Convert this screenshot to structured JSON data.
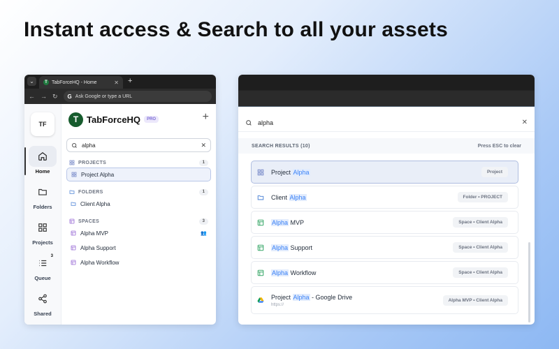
{
  "headline": "Instant access & Search to all your assets",
  "browser": {
    "tab_title": "TabForceHQ - Home",
    "tab_favicon": "T",
    "address_placeholder": "Ask Google or type a URL",
    "address_g": "G"
  },
  "sidebar": {
    "avatar": "TF",
    "items": [
      {
        "label": "Home",
        "icon": "home-icon"
      },
      {
        "label": "Folders",
        "icon": "folder-icon"
      },
      {
        "label": "Projects",
        "icon": "grid-icon"
      },
      {
        "label": "Queue",
        "icon": "queue-icon",
        "badge": "3"
      },
      {
        "label": "Shared",
        "icon": "share-icon"
      }
    ]
  },
  "panel": {
    "brand_logo": "T",
    "brand_name": "TabForceHQ",
    "plan_badge": "PRO",
    "search_value": "alpha",
    "sections": {
      "projects": {
        "title": "PROJECTS",
        "count": "1",
        "items": [
          "Project Alpha"
        ]
      },
      "folders": {
        "title": "FOLDERS",
        "count": "1",
        "items": [
          "Client Alpha"
        ]
      },
      "spaces": {
        "title": "SPACES",
        "count": "3",
        "items": [
          "Alpha MVP",
          "Alpha Support",
          "Alpha Workflow"
        ]
      }
    }
  },
  "results": {
    "search_value": "alpha",
    "header": "SEARCH RESULTS (10)",
    "esc_hint": "Press ESC to clear",
    "items": [
      {
        "pre": "Project ",
        "hl": "Alpha",
        "post": "",
        "tag": "Project",
        "icon": "grid-icon"
      },
      {
        "pre": "Client ",
        "hl": "Alpha",
        "post": "",
        "tag": "Folder • PROJECT",
        "icon": "folder-icon"
      },
      {
        "pre": "",
        "hl": "Alpha",
        "post": " MVP",
        "tag": "Space • Client Alpha",
        "icon": "space-icon"
      },
      {
        "pre": "",
        "hl": "Alpha",
        "post": " Support",
        "tag": "Space • Client Alpha",
        "icon": "space-icon"
      },
      {
        "pre": "",
        "hl": "Alpha",
        "post": " Workflow",
        "tag": "Space • Client Alpha",
        "icon": "space-icon"
      },
      {
        "pre": "Project ",
        "hl": "Alpha",
        "post": " - Google Drive",
        "sub": "https://",
        "tag": "Alpha MVP • Client Alpha",
        "icon": "google-drive-icon"
      }
    ]
  },
  "colors": {
    "brand_green": "#175c2e",
    "highlight_blue": "#3b82f6",
    "selection_bg": "#e9eef8"
  }
}
